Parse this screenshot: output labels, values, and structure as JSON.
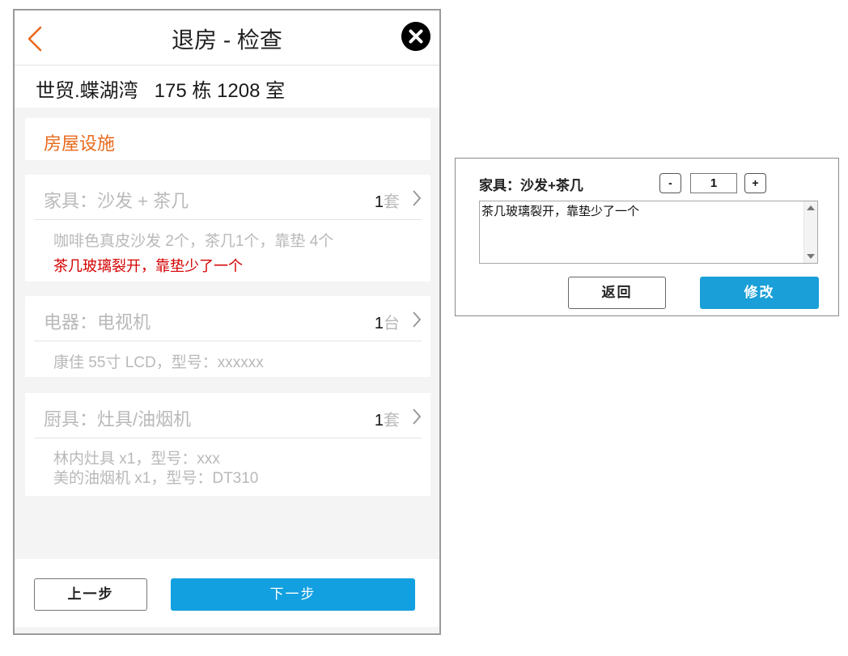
{
  "header": {
    "title": "退房 - 检查",
    "back_icon": "chevron-left-icon",
    "close_icon": "close-circle-icon",
    "accent_color": "#e86a1c"
  },
  "address": "世贸.蝶湖湾   175 栋 1208 室",
  "section": {
    "title": "房屋设施"
  },
  "items": [
    {
      "name": "家具：沙发 + 茶几",
      "count": "1",
      "unit": "套",
      "description": "咖啡色真皮沙发 2个，茶几1个，靠垫 4个",
      "issue": "茶几玻璃裂开，靠垫少了一个"
    },
    {
      "name": "电器：电视机",
      "count": "1",
      "unit": "台",
      "description": "康佳 55寸 LCD，型号：xxxxxx"
    },
    {
      "name": "厨具：灶具/油烟机",
      "count": "1",
      "unit": "套",
      "description_lines": [
        "林内灶具 x1，型号：xxx",
        "美的油烟机 x1，型号：DT310"
      ]
    }
  ],
  "footer": {
    "prev_label": "上一步",
    "next_label": "下一步",
    "next_color": "#12a0e0"
  },
  "dialog": {
    "label": "家具：沙发+茶几",
    "minus": "-",
    "quantity": "1",
    "plus": "+",
    "note": "茶几玻璃裂开，靠垫少了一个",
    "back_label": "返回",
    "save_label": "修改",
    "save_color": "#1a9fd8"
  }
}
